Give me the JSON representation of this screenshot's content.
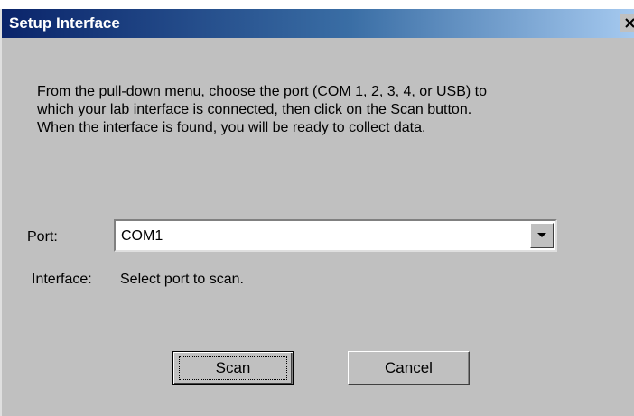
{
  "window": {
    "title": "Setup Interface"
  },
  "instructions": {
    "lines": [
      "From the pull-down menu, choose the port (COM 1, 2, 3, 4, or USB) to",
      "which your lab interface is connected, then click on the Scan button.",
      "When the interface is found, you will be ready to collect data."
    ]
  },
  "port": {
    "label": "Port:",
    "selected": "COM1"
  },
  "interface": {
    "label": "Interface:",
    "status": "Select port to scan."
  },
  "buttons": {
    "scan": "Scan",
    "cancel": "Cancel"
  },
  "icons": {
    "close": "close-icon",
    "dropdown": "chevron-down-icon"
  },
  "colors": {
    "titlebar_start": "#0a246a",
    "titlebar_end": "#a6caf0",
    "dialog_face": "#c0c0c0"
  }
}
